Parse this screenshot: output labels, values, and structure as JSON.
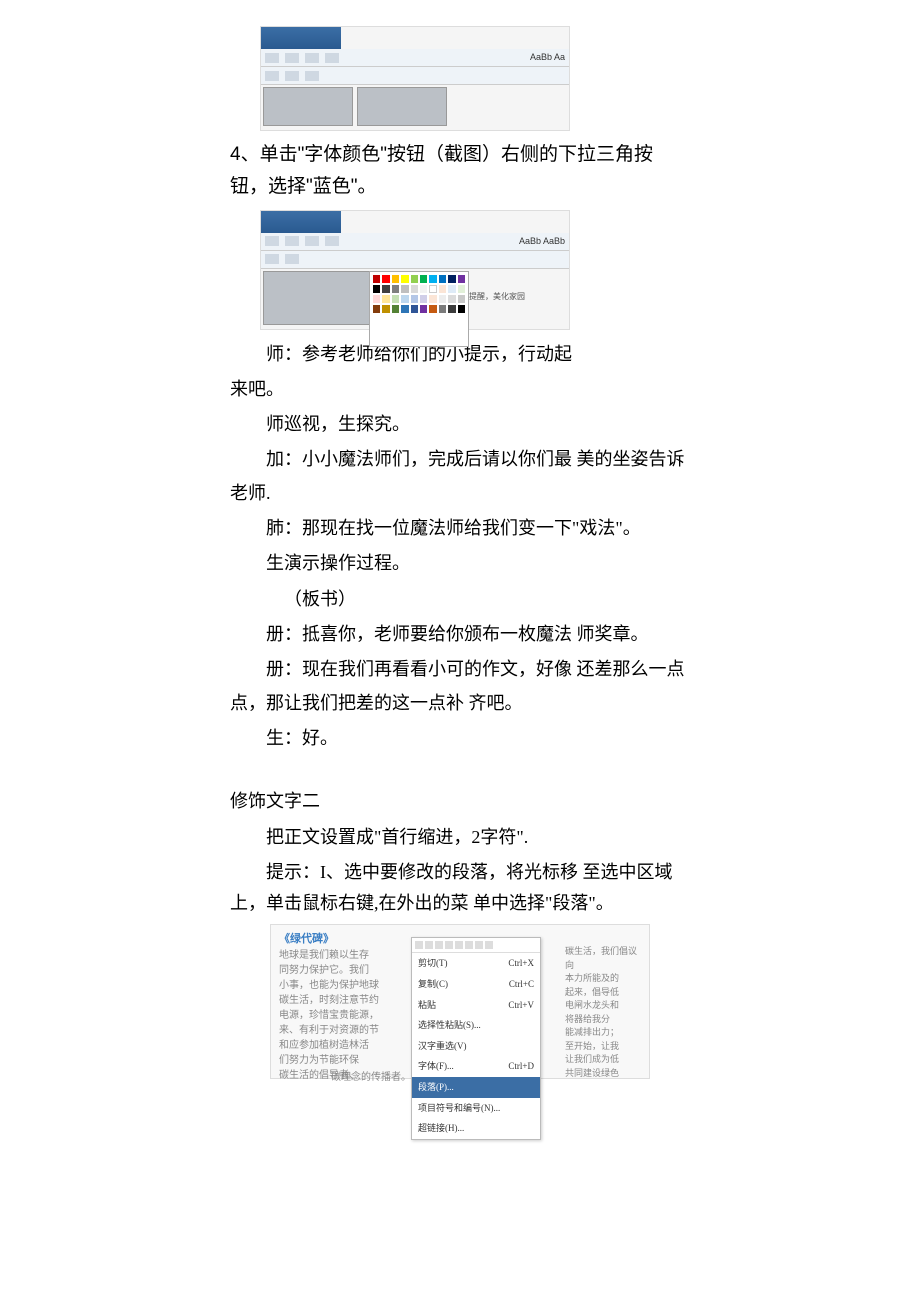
{
  "screenshot1": {
    "styles_text": "AaBb Aa"
  },
  "instruction1": "4、单击\"字体颜色\"按钮（截图）右侧的下拉三角按钮，选择\"蓝色\"。",
  "screenshot2": {
    "styles_text": "AaBb AaBb",
    "sidebox_title": "温馨提醒，美化家园"
  },
  "p1": "师：参考老师给你们的小提示，行动起",
  "p1b": "来吧。",
  "p2": "师巡视，生探究。",
  "p3": "加：小小魔法师们，完成后请以你们最  美的坐姿告诉老师.",
  "p4": "肺：那现在找一位魔法师给我们变一下\"戏法\"。",
  "p5": "生演示操作过程。",
  "p6": "（板书）",
  "p7": "册：抵喜你，老师要给你颁布一枚魔法  师奖章。",
  "p8": "册：现在我们再看看小可的作文，好像  还差那么一点点，那让我们把差的这一点补  齐吧。",
  "p9": "生：好。",
  "section2_title": "修饰文字二",
  "s2_p1": "把正文设置成\"首行缩进，2字符\".",
  "s2_p2": "提示：I、选中要修改的段落，将光标移 至选中区域上，单击鼠标右键,在外出的菜 单中选择\"段落\"。",
  "ss3_title": "《绿代碑》",
  "ss3_bg_left": "地球是我们赖以生存\n同努力保护它。我们\n小事，也能为保护地球\n碳生活，时刻注意节约\n电源，珍惜宝贵能源，\n来、有利于对资源的节\n和应参加植树造林活\n们努力为节能环保\n碳生活的倡导者、",
  "ss3_bg_right": "碳生活，我们倡议向\n本力所能及的\n起来，倡导低\n电闸水龙头和\n将器给我分\n能减排出力；\n至开始，让我\n让我们成为低\n共同建设绿色",
  "ss3_bg_bottom": "碳理念的传播者。携起手来，",
  "ss3_menu": {
    "items": [
      {
        "label": "剪切(T)",
        "shortcut": "Ctrl+X"
      },
      {
        "label": "复制(C)",
        "shortcut": "Ctrl+C"
      },
      {
        "label": "粘贴",
        "shortcut": "Ctrl+V"
      },
      {
        "label": "选择性粘贴(S)...",
        "shortcut": ""
      },
      {
        "label": "汉字重选(V)",
        "shortcut": ""
      },
      {
        "label": "字体(F)...",
        "shortcut": "Ctrl+D"
      },
      {
        "label": "段落(P)...",
        "shortcut": ""
      },
      {
        "label": "项目符号和编号(N)...",
        "shortcut": ""
      },
      {
        "label": "超链接(H)...",
        "shortcut": ""
      }
    ]
  }
}
